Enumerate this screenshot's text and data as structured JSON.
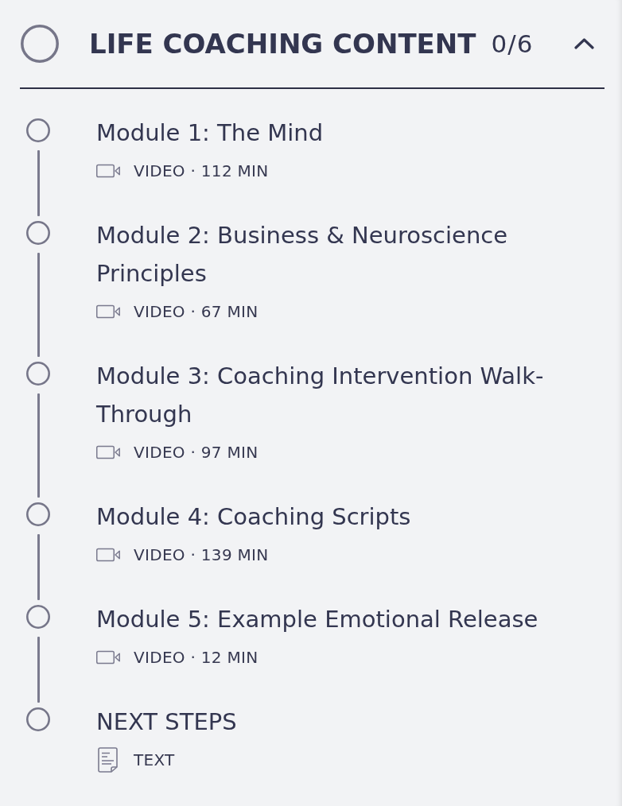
{
  "section": {
    "title": "LIFE COACHING CONTENT",
    "progress": "0/6",
    "completed": false,
    "expanded": true
  },
  "items": [
    {
      "kind": "video",
      "title": "Module 1: The Mind",
      "meta": "VIDEO · 112 MIN",
      "completed": false
    },
    {
      "kind": "video",
      "title": "Module 2: Business & Neuroscience Principles",
      "meta": "VIDEO · 67 MIN",
      "completed": false
    },
    {
      "kind": "video",
      "title": "Module 3: Coaching Intervention Walk-Through",
      "meta": "VIDEO · 97 MIN",
      "completed": false
    },
    {
      "kind": "video",
      "title": "Module 4: Coaching Scripts",
      "meta": "VIDEO · 139 MIN",
      "completed": false
    },
    {
      "kind": "video",
      "title": "Module 5: Example Emotional Release",
      "meta": "VIDEO · 12 MIN",
      "completed": false
    },
    {
      "kind": "text",
      "title": "NEXT STEPS",
      "meta": "TEXT",
      "completed": false
    }
  ]
}
